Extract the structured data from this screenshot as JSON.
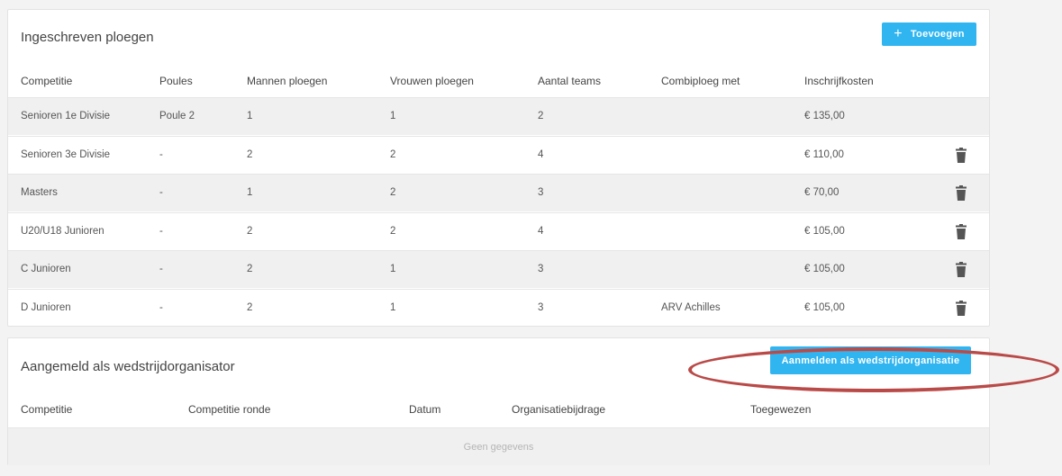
{
  "teams_card": {
    "title": "Ingeschreven ploegen",
    "add_button": {
      "icon": "plus-icon",
      "label": "Toevoegen"
    },
    "columns": [
      "Competitie",
      "Poules",
      "Mannen ploegen",
      "Vrouwen ploegen",
      "Aantal teams",
      "Combiploeg met",
      "Inschrijfkosten"
    ],
    "rows": [
      {
        "competitie": "Senioren 1e Divisie",
        "poules": "Poule 2",
        "mannen": "1",
        "vrouwen": "1",
        "aantal": "2",
        "combi": "",
        "kosten": "€ 135,00",
        "deletable": false
      },
      {
        "competitie": "Senioren 3e Divisie",
        "poules": "-",
        "mannen": "2",
        "vrouwen": "2",
        "aantal": "4",
        "combi": "",
        "kosten": "€ 110,00",
        "deletable": true
      },
      {
        "competitie": "Masters",
        "poules": "-",
        "mannen": "1",
        "vrouwen": "2",
        "aantal": "3",
        "combi": "",
        "kosten": "€ 70,00",
        "deletable": true
      },
      {
        "competitie": "U20/U18 Junioren",
        "poules": "-",
        "mannen": "2",
        "vrouwen": "2",
        "aantal": "4",
        "combi": "",
        "kosten": "€ 105,00",
        "deletable": true
      },
      {
        "competitie": "C Junioren",
        "poules": "-",
        "mannen": "2",
        "vrouwen": "1",
        "aantal": "3",
        "combi": "",
        "kosten": "€ 105,00",
        "deletable": true
      },
      {
        "competitie": "D Junioren",
        "poules": "-",
        "mannen": "2",
        "vrouwen": "1",
        "aantal": "3",
        "combi": "ARV Achilles",
        "kosten": "€ 105,00",
        "deletable": true
      }
    ]
  },
  "organizer_card": {
    "title": "Aangemeld als wedstrijdorganisator",
    "register_button": "Aanmelden als wedstrijdorganisatie",
    "columns": [
      "Competitie",
      "Competitie ronde",
      "Datum",
      "Organisatiebijdrage",
      "Toegewezen"
    ],
    "empty_text": "Geen gegevens"
  },
  "colors": {
    "accent": "#30b5f0",
    "highlight": "#b94a48",
    "row_alt": "#f0f0f0"
  }
}
